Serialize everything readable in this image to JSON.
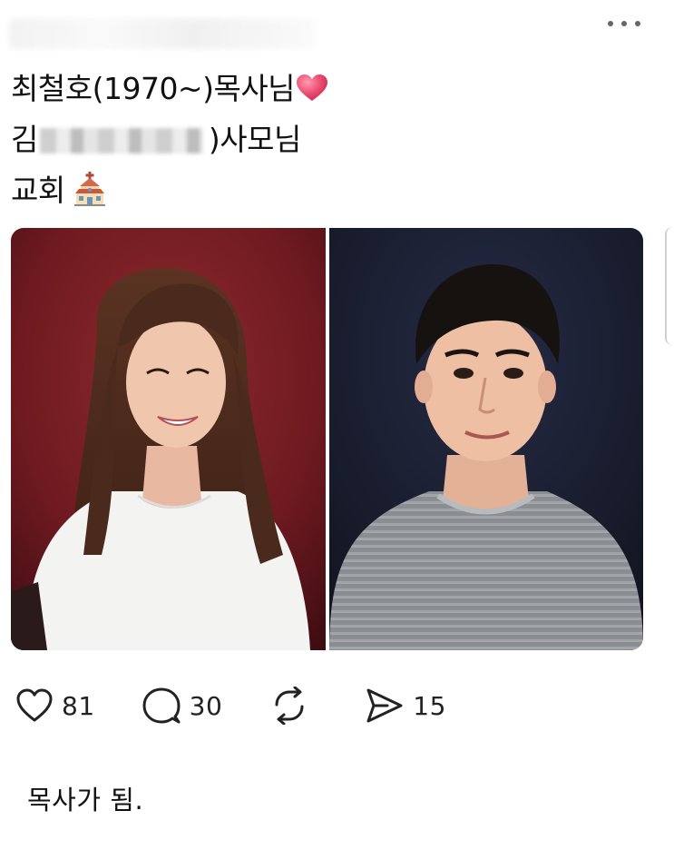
{
  "post": {
    "line1_text": "최철호(1970~)목사님",
    "line1_emoji": "heart",
    "line2_prefix": "김",
    "line2_suffix": ")사모님",
    "line3_text": "교회",
    "line3_emoji": "church"
  },
  "actions": {
    "like_count": "81",
    "reply_count": "30",
    "repost_count": "",
    "share_count": "15"
  },
  "caption": "목사가 됨.",
  "colors": {
    "heart": "#e84a6e",
    "left_backdrop": "#7a1c22",
    "right_backdrop": "#1b2036",
    "icon": "#222222"
  }
}
